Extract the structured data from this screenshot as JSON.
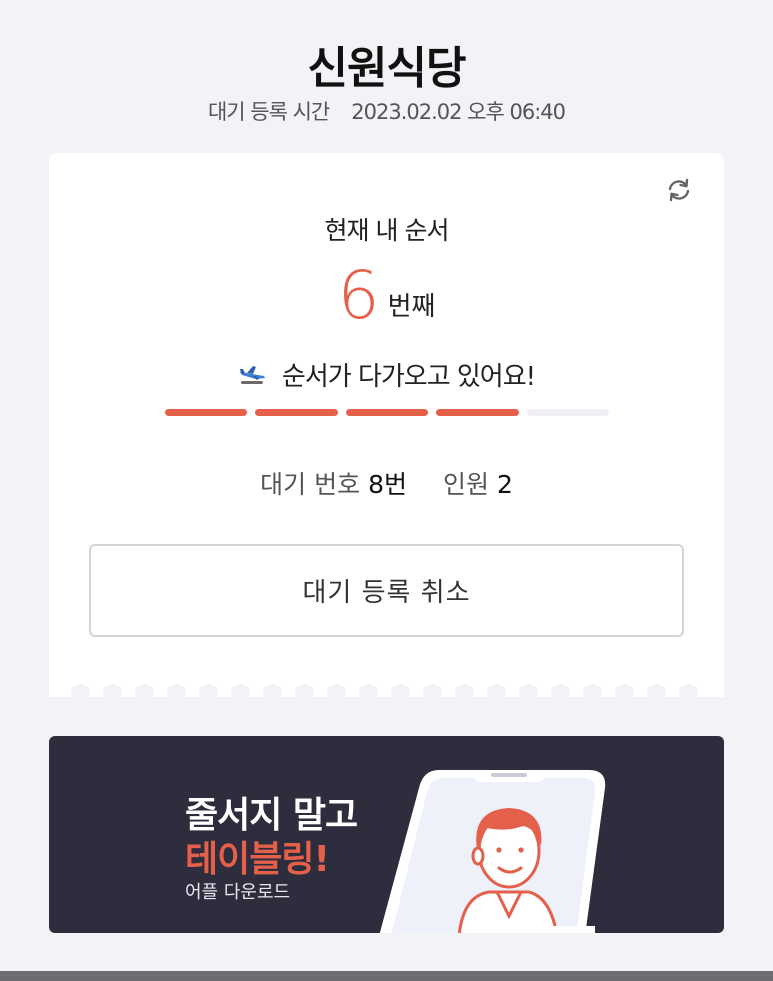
{
  "header": {
    "restaurant_name": "신원식당",
    "registration_label": "대기 등록 시간",
    "registration_time": "2023.02.02 오후 06:40"
  },
  "queue": {
    "title": "현재 내 순서",
    "position": "6",
    "position_suffix": "번째",
    "message": "순서가 다가오고 있어요!",
    "progress": {
      "segments_total": 5,
      "segments_filled": 4
    },
    "waiting_number_label": "대기 번호",
    "waiting_number_value": "8번",
    "party_size_label": "인원",
    "party_size_value": "2",
    "cancel_label": "대기 등록 취소"
  },
  "banner": {
    "line1": "줄서지 말고",
    "line2": "테이블링!",
    "subtext": "어플 다운로드"
  },
  "icons": {
    "refresh": "refresh-icon",
    "message": "airplane-icon",
    "banner_image": "phone-illustration"
  },
  "colors": {
    "accent": "#e4604a",
    "background": "#f2f2f7",
    "banner_bg": "#2e2d3e",
    "progress_empty": "#f0f0f4"
  }
}
